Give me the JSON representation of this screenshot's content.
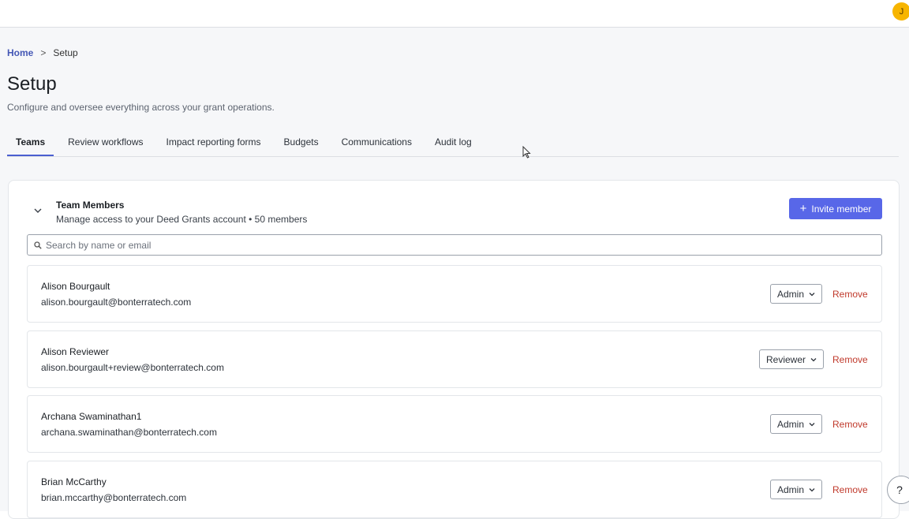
{
  "header": {
    "avatar_initial": "J"
  },
  "breadcrumb": {
    "home": "Home",
    "separator": ">",
    "current": "Setup"
  },
  "page": {
    "title": "Setup",
    "subtitle": "Configure and oversee everything across your grant operations."
  },
  "tabs": [
    {
      "label": "Teams",
      "active": true
    },
    {
      "label": "Review workflows",
      "active": false
    },
    {
      "label": "Impact reporting forms",
      "active": false
    },
    {
      "label": "Budgets",
      "active": false
    },
    {
      "label": "Communications",
      "active": false
    },
    {
      "label": "Audit log",
      "active": false
    }
  ],
  "team_section": {
    "title": "Team Members",
    "description": "Manage access to your Deed Grants account • 50 members",
    "invite_label": "Invite member",
    "search_placeholder": "Search by name or email"
  },
  "members": [
    {
      "name": "Alison Bourgault",
      "email": "alison.bourgault@bonterratech.com",
      "role": "Admin",
      "remove_label": "Remove"
    },
    {
      "name": "Alison Reviewer",
      "email": "alison.bourgault+review@bonterratech.com",
      "role": "Reviewer",
      "remove_label": "Remove"
    },
    {
      "name": "Archana Swaminathan1",
      "email": "archana.swaminathan@bonterratech.com",
      "role": "Admin",
      "remove_label": "Remove"
    },
    {
      "name": "Brian McCarthy",
      "email": "brian.mccarthy@bonterratech.com",
      "role": "Admin",
      "remove_label": "Remove"
    }
  ],
  "help": {
    "label": "?"
  },
  "colors": {
    "accent": "#5867e8",
    "link": "#4457b5",
    "danger": "#c0392b",
    "avatar": "#f7b500"
  }
}
